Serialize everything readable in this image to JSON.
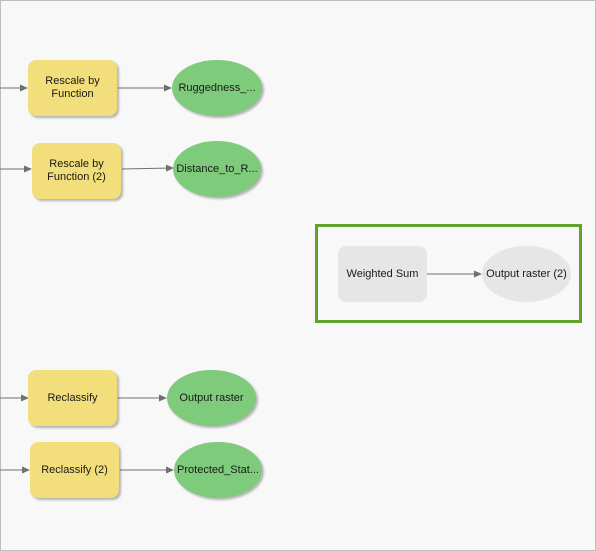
{
  "diagram": {
    "type": "model-builder",
    "nodes": [
      {
        "id": "rescale1",
        "kind": "tool",
        "label": "Rescale by Function",
        "state": "ready"
      },
      {
        "id": "ruggedness",
        "kind": "data",
        "label": "Ruggedness_...",
        "state": "ready"
      },
      {
        "id": "rescale2",
        "kind": "tool",
        "label": "Rescale by Function (2)",
        "state": "ready"
      },
      {
        "id": "distance",
        "kind": "data",
        "label": "Distance_to_R...",
        "state": "ready"
      },
      {
        "id": "weighted_sum",
        "kind": "tool",
        "label": "Weighted Sum",
        "state": "not-ready",
        "selected": true
      },
      {
        "id": "output_raster2",
        "kind": "data",
        "label": "Output raster (2)",
        "state": "not-ready",
        "selected": true
      },
      {
        "id": "reclassify1",
        "kind": "tool",
        "label": "Reclassify",
        "state": "ready"
      },
      {
        "id": "output_raster",
        "kind": "data",
        "label": "Output raster",
        "state": "ready"
      },
      {
        "id": "reclassify2",
        "kind": "tool",
        "label": "Reclassify (2)",
        "state": "ready"
      },
      {
        "id": "protected",
        "kind": "data",
        "label": "Protected_Stat...",
        "state": "ready"
      }
    ],
    "connections": [
      {
        "from": "offscreen",
        "to": "rescale1"
      },
      {
        "from": "rescale1",
        "to": "ruggedness"
      },
      {
        "from": "offscreen",
        "to": "rescale2"
      },
      {
        "from": "rescale2",
        "to": "distance"
      },
      {
        "from": "weighted_sum",
        "to": "output_raster2"
      },
      {
        "from": "offscreen",
        "to": "reclassify1"
      },
      {
        "from": "reclassify1",
        "to": "output_raster"
      },
      {
        "from": "offscreen",
        "to": "reclassify2"
      },
      {
        "from": "reclassify2",
        "to": "protected"
      }
    ],
    "colors": {
      "canvas": "#f8f8f8",
      "tool_ready": "#f2de7a",
      "data_ready": "#7dcb7b",
      "not_ready": "#e6e6e6",
      "selection": "#62a12c",
      "connector": "#707070"
    }
  }
}
